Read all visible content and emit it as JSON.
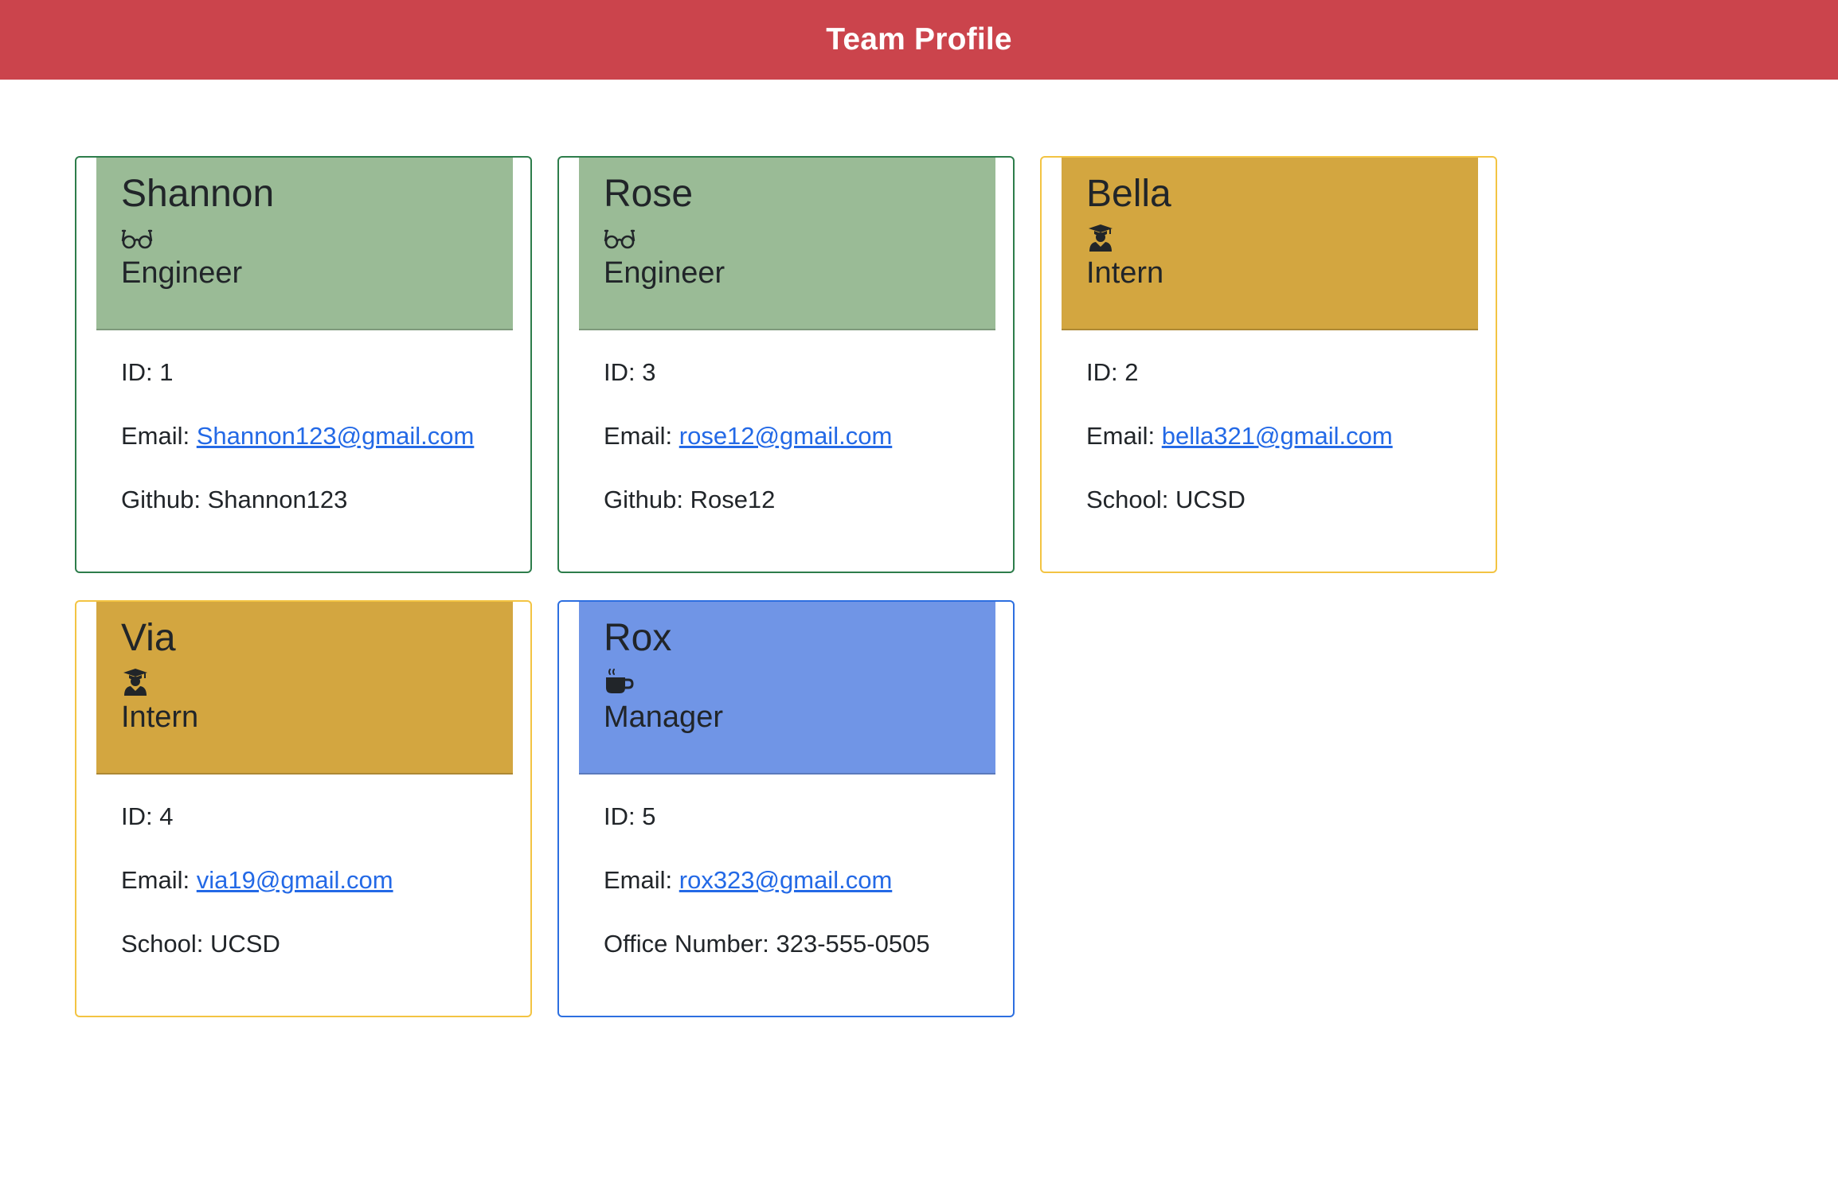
{
  "header": {
    "title": "Team Profile"
  },
  "labels": {
    "id": "ID: ",
    "email": "Email: ",
    "github": "Github: ",
    "school": "School: ",
    "office": "Office Number: "
  },
  "colors": {
    "header_bg": "#cb444c",
    "engineer_head": "#9abb96",
    "engineer_border": "#2d7d4b",
    "intern_head": "#d3a640",
    "intern_border": "#f3c443",
    "manager_head": "#7095e6",
    "manager_border": "#2d6fe0",
    "link": "#2369e6"
  },
  "team": [
    {
      "name": "Shannon",
      "role": "Engineer",
      "icon": "glasses-icon",
      "id": "1",
      "email": "Shannon123@gmail.com",
      "extra_label": "Github: ",
      "extra_value": "Shannon123"
    },
    {
      "name": "Rose",
      "role": "Engineer",
      "icon": "glasses-icon",
      "id": "3",
      "email": "rose12@gmail.com",
      "extra_label": "Github: ",
      "extra_value": "Rose12"
    },
    {
      "name": "Bella",
      "role": "Intern",
      "icon": "graduate-icon",
      "id": "2",
      "email": "bella321@gmail.com",
      "extra_label": "School: ",
      "extra_value": "UCSD"
    },
    {
      "name": "Via",
      "role": "Intern",
      "icon": "graduate-icon",
      "id": "4",
      "email": "via19@gmail.com",
      "extra_label": "School: ",
      "extra_value": "UCSD"
    },
    {
      "name": "Rox",
      "role": "Manager",
      "icon": "coffee-mug-icon",
      "id": "5",
      "email": "rox323@gmail.com",
      "extra_label": "Office Number: ",
      "extra_value": "323-555-0505"
    }
  ]
}
